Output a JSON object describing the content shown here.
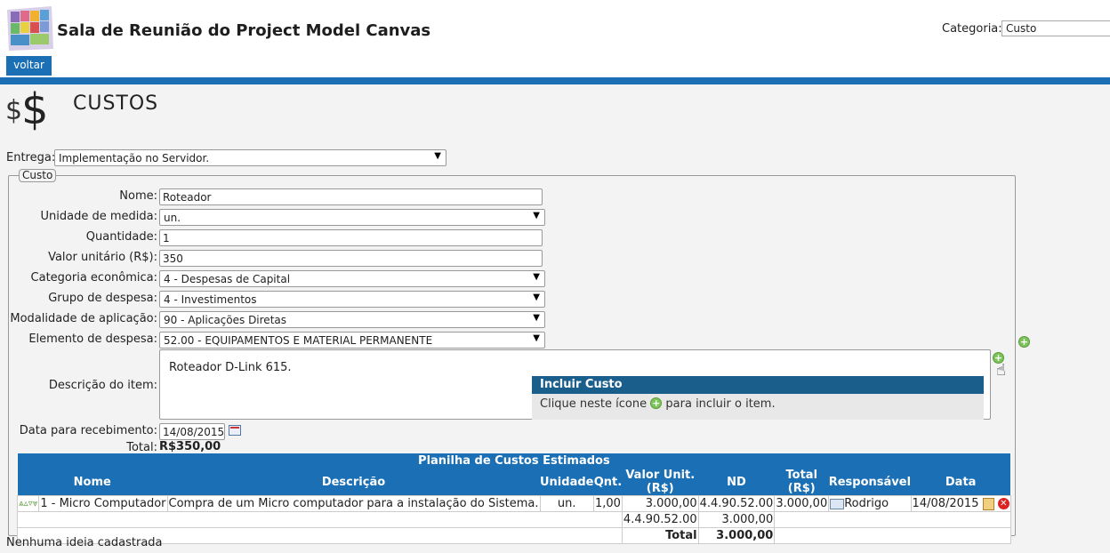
{
  "header": {
    "title": "Sala de Reunião do Project Model Canvas",
    "category_label": "Categoria:",
    "category_value": "Custo",
    "back_label": "voltar"
  },
  "section": {
    "heading": "CUSTOS",
    "entrega_label": "Entrega:",
    "entrega_value": "Implementação no Servidor."
  },
  "form": {
    "legend": "Custo",
    "nome_label": "Nome:",
    "nome_value": "Roteador",
    "unidade_label": "Unidade de medida:",
    "unidade_value": "un.",
    "quantidade_label": "Quantidade:",
    "quantidade_value": "1",
    "valor_label": "Valor unitário (R$):",
    "valor_value": "350",
    "categoria_label": "Categoria econômica:",
    "categoria_value": "4 - Despesas de Capital",
    "grupo_label": "Grupo de despesa:",
    "grupo_value": "4 - Investimentos",
    "modalidade_label": "Modalidade de aplicação:",
    "modalidade_value": "90 - Aplicações Diretas",
    "elemento_label": "Elemento de despesa:",
    "elemento_value": "52.00 - EQUIPAMENTOS E MATERIAL PERMANENTE",
    "descricao_label": "Descrição do item:",
    "descricao_value": "Roteador D-Link 615.",
    "data_label": "Data para recebimento:",
    "data_value": "14/08/2015",
    "total_label": "Total:",
    "total_value": "R$350,00"
  },
  "tooltip": {
    "title": "Incluir Custo",
    "text_before": "Clique neste ícone",
    "text_after": "para incluir o item."
  },
  "table": {
    "caption": "Planilha de Custos Estimados",
    "headers": [
      "Nome",
      "Descrição",
      "Unidade",
      "Qnt.",
      "Valor Unit.(R$)",
      "ND",
      "Total (R$)",
      "Responsável",
      "Data"
    ],
    "rows": [
      {
        "nome": "1 - Micro Computador",
        "descricao": "Compra de um Micro computador para a instalação do Sistema.",
        "unidade": "un.",
        "qnt": "1,00",
        "valor_unit": "3.000,00",
        "nd": "4.4.90.52.00",
        "total": "3.000,00",
        "responsavel": "Rodrigo",
        "data": "14/08/2015"
      }
    ],
    "summary_nd": "4.4.90.52.00",
    "summary_value": "3.000,00",
    "total_label": "Total",
    "total_value": "3.000,00"
  },
  "footer": {
    "ideas_text": "Nenhuma ideia cadastrada"
  },
  "colors": {
    "accent": "#1a6fb5",
    "tooltip_header": "#1a5f8c",
    "add_icon": "#7cc45a"
  }
}
